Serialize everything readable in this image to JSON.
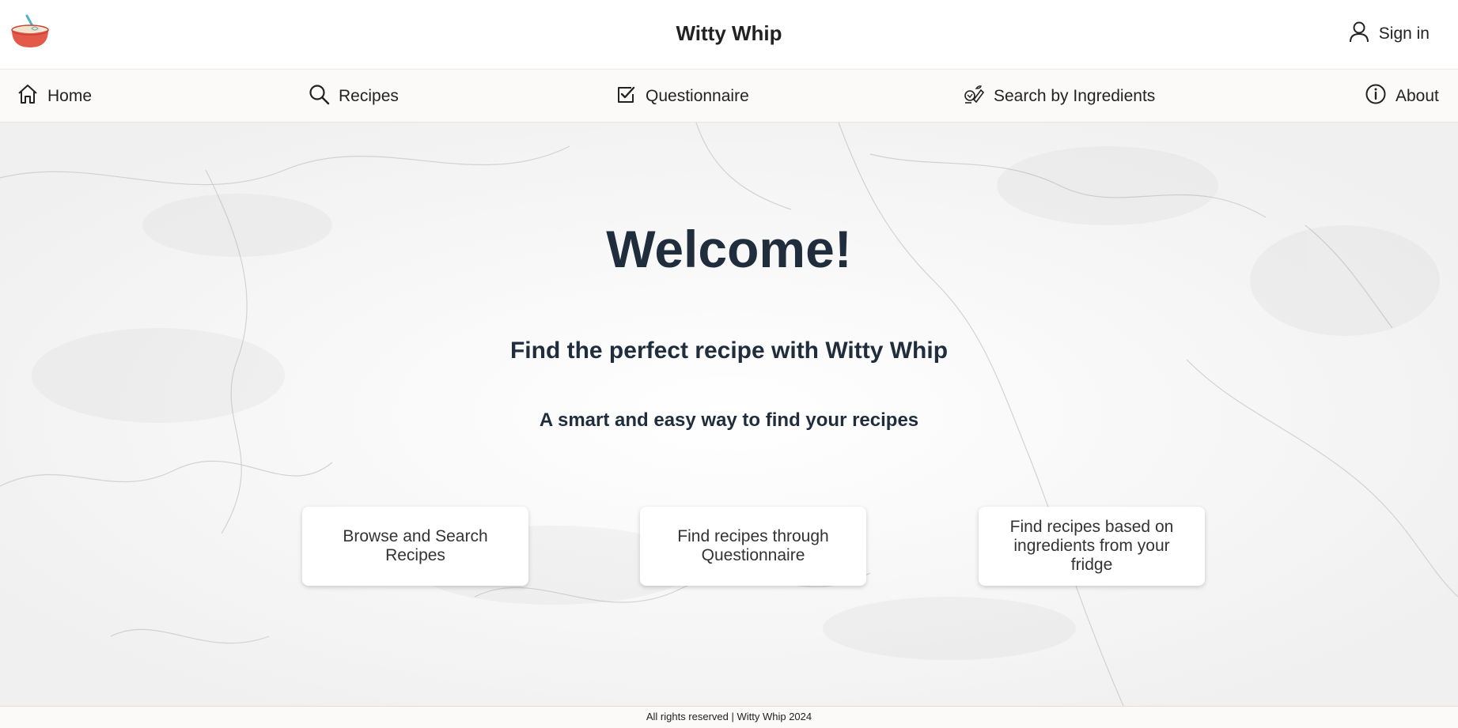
{
  "header": {
    "title": "Witty Whip",
    "logo_icon": "bowl-whisk-icon",
    "signin_label": "Sign in",
    "signin_icon": "user-icon"
  },
  "nav": {
    "items": [
      {
        "label": "Home",
        "icon": "home-icon"
      },
      {
        "label": "Recipes",
        "icon": "search-icon"
      },
      {
        "label": "Questionnaire",
        "icon": "checkbox-icon"
      },
      {
        "label": "Search by Ingredients",
        "icon": "ingredients-icon"
      },
      {
        "label": "About",
        "icon": "info-icon"
      }
    ]
  },
  "hero": {
    "title": "Welcome!",
    "subtitle": "Find the perfect recipe with Witty Whip",
    "tagline": "A smart and easy way to find your recipes"
  },
  "cards": [
    {
      "label": "Browse and Search Recipes"
    },
    {
      "label": "Find recipes through Questionnaire"
    },
    {
      "label": "Find recipes based on ingredients from your fridge"
    }
  ],
  "footer": {
    "text": "All rights reserved | Witty Whip 2024"
  },
  "colors": {
    "heading": "#1f2d3d",
    "nav_bg": "#fbfaf8",
    "logo_bowl": "#e35a4b"
  }
}
